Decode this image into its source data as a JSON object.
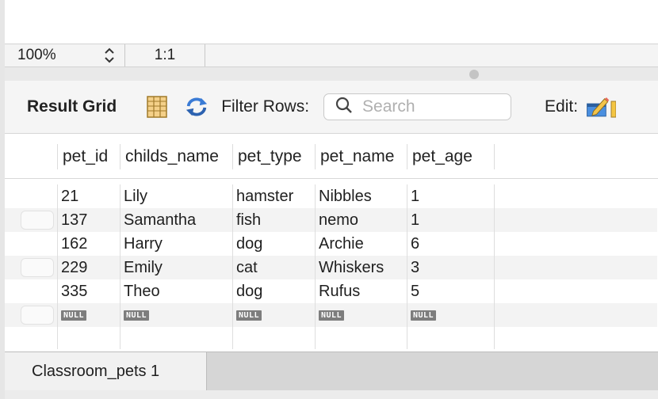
{
  "status_bar": {
    "zoom": "100%",
    "ratio": "1:1"
  },
  "toolbar": {
    "title": "Result Grid",
    "filter_label": "Filter Rows:",
    "search_placeholder": "Search",
    "edit_label": "Edit:",
    "icons": [
      "form-editor-icon",
      "refresh-icon",
      "search-icon",
      "edit-pencil-icon"
    ]
  },
  "grid": {
    "columns": [
      "pet_id",
      "childs_name",
      "pet_type",
      "pet_name",
      "pet_age"
    ],
    "rows": [
      [
        "21",
        "Lily",
        "hamster",
        "Nibbles",
        "1"
      ],
      [
        "137",
        "Samantha",
        "fish",
        "nemo",
        "1"
      ],
      [
        "162",
        "Harry",
        "dog",
        "Archie",
        "6"
      ],
      [
        "229",
        "Emily",
        "cat",
        "Whiskers",
        "3"
      ],
      [
        "335",
        "Theo",
        "dog",
        "Rufus",
        "5"
      ]
    ],
    "null_row": [
      "NULL",
      "NULL",
      "NULL",
      "NULL",
      "NULL"
    ]
  },
  "tabs": [
    {
      "label": "Classroom_pets 1"
    }
  ]
}
